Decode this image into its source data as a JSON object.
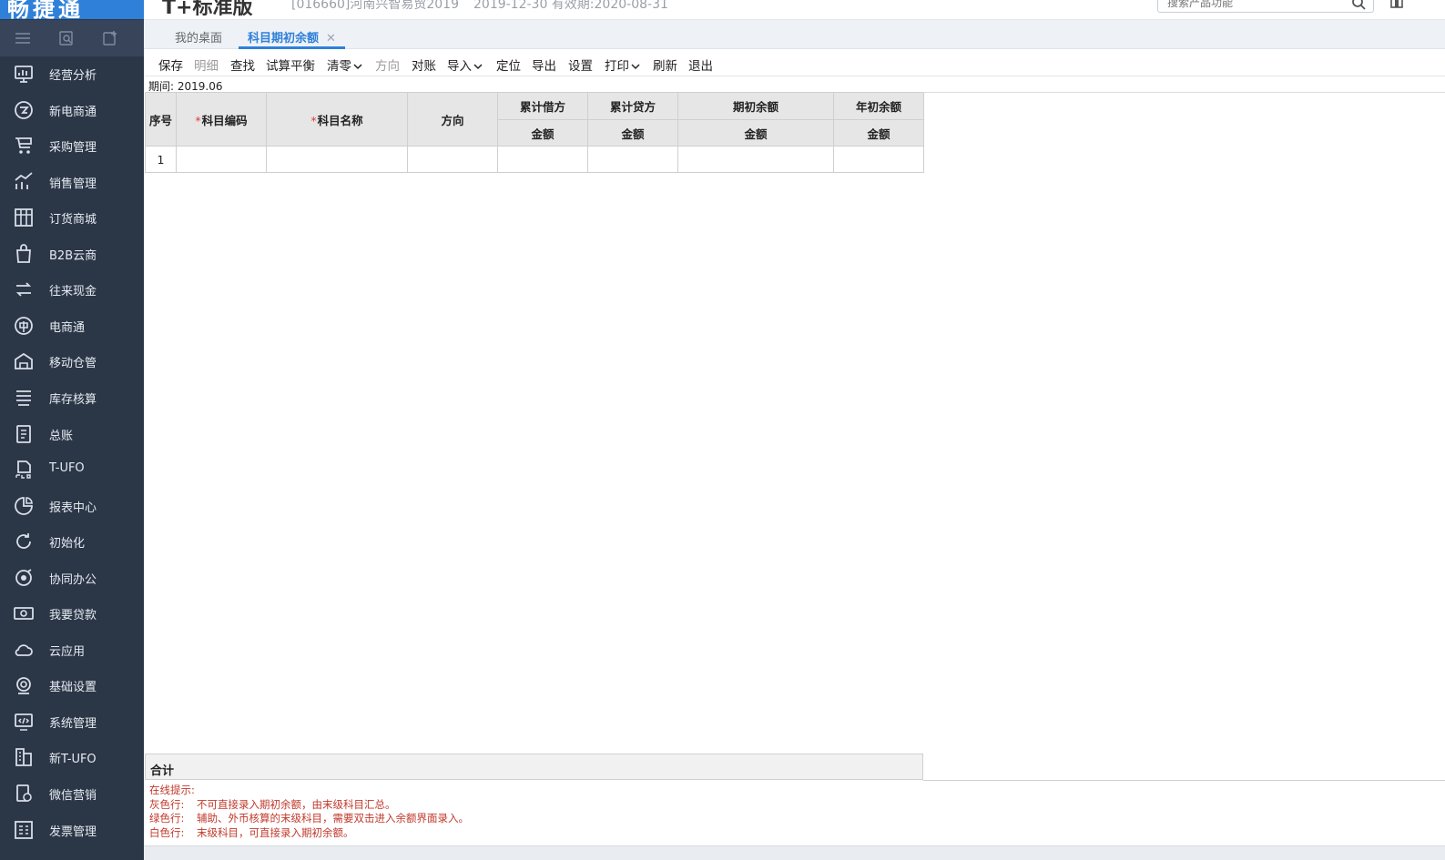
{
  "app": {
    "logo": "畅捷通",
    "edition": "T+标准版",
    "account": "[016660]河南兴智易贸2019",
    "dates": "2019-12-30   有效期:2020-08-31"
  },
  "search": {
    "placeholder": "搜索产品功能"
  },
  "sidebar": {
    "items": [
      {
        "label": "经营分析",
        "icon": "chart-monitor-icon"
      },
      {
        "label": "新电商通",
        "icon": "ecommerce-circle-icon"
      },
      {
        "label": "采购管理",
        "icon": "cart-icon"
      },
      {
        "label": "销售管理",
        "icon": "sales-growth-icon"
      },
      {
        "label": "订货商城",
        "icon": "store-icon"
      },
      {
        "label": "B2B云商",
        "icon": "shopping-bag-icon"
      },
      {
        "label": "往来现金",
        "icon": "exchange-arrows-icon"
      },
      {
        "label": "电商通",
        "icon": "electric-circle-icon"
      },
      {
        "label": "移动仓管",
        "icon": "warehouse-icon"
      },
      {
        "label": "库存核算",
        "icon": "inventory-icon"
      },
      {
        "label": "总账",
        "icon": "ledger-icon"
      },
      {
        "label": "T-UFO",
        "icon": "ufo-report-icon"
      },
      {
        "label": "报表中心",
        "icon": "pie-chart-icon"
      },
      {
        "label": "初始化",
        "icon": "refresh-icon"
      },
      {
        "label": "协同办公",
        "icon": "collaboration-icon"
      },
      {
        "label": "我要贷款",
        "icon": "money-icon"
      },
      {
        "label": "云应用",
        "icon": "cloud-icon"
      },
      {
        "label": "基础设置",
        "icon": "settings-gear-icon"
      },
      {
        "label": "系统管理",
        "icon": "system-code-icon"
      },
      {
        "label": "新T-UFO",
        "icon": "building-icon"
      },
      {
        "label": "微信营销",
        "icon": "wechat-marketing-icon"
      },
      {
        "label": "发票管理",
        "icon": "invoice-icon"
      }
    ]
  },
  "tabs": {
    "desktop": "我的桌面",
    "active": "科目期初余额",
    "close": "✕"
  },
  "toolbar": {
    "save": "保存",
    "detail": "明细",
    "find": "查找",
    "trial_balance": "试算平衡",
    "clear": "清零",
    "direction": "方向",
    "reconcile": "对账",
    "import": "导入",
    "locate": "定位",
    "export": "导出",
    "settings": "设置",
    "print": "打印",
    "refresh": "刷新",
    "exit": "退出"
  },
  "period": {
    "text": "期间: 2019.06"
  },
  "grid": {
    "headers": {
      "seq": "序号",
      "code": "科目编码",
      "name": "科目名称",
      "direction": "方向",
      "debit": "累计借方",
      "credit": "累计贷方",
      "opening": "期初余额",
      "year_opening": "年初余额",
      "amount": "金额",
      "required_mark": "*"
    },
    "rows": [
      {
        "seq": "1"
      }
    ]
  },
  "total": {
    "label": "合计"
  },
  "hints": {
    "title": "在线提示:",
    "lines": [
      {
        "key": "灰色行:",
        "text": "不可直接录入期初余额，由末级科目汇总。"
      },
      {
        "key": "绿色行:",
        "text": "辅助、外币核算的末级科目，需要双击进入余额界面录入。"
      },
      {
        "key": "白色行:",
        "text": "末级科目，可直接录入期初余额。"
      }
    ]
  },
  "colors": {
    "sidebar_bg": "#2b3747",
    "accent": "#2f80d8",
    "hint_red": "#c0392b"
  }
}
